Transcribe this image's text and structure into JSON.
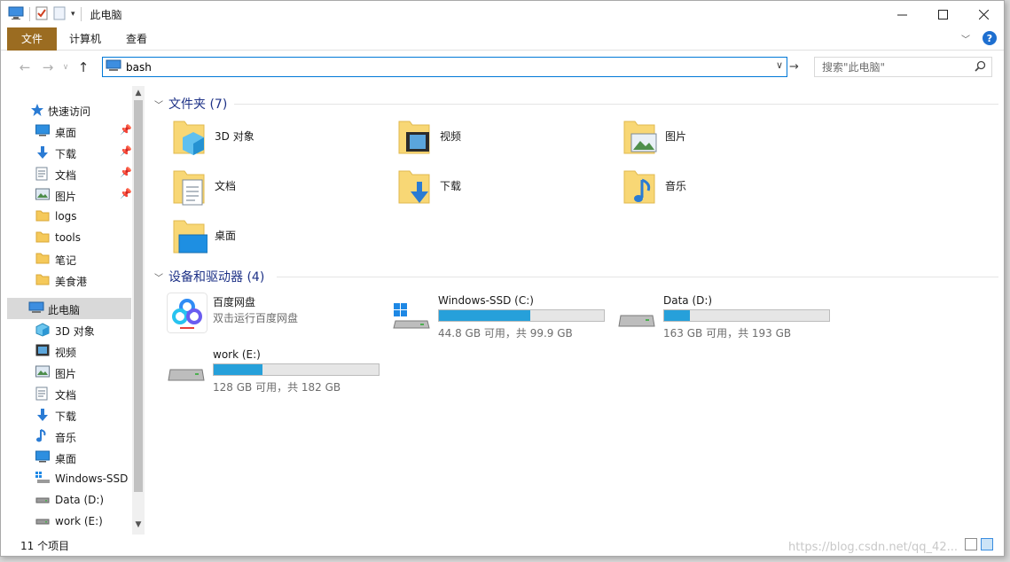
{
  "window": {
    "title": "此电脑"
  },
  "ribbon": {
    "tabs": [
      {
        "label": "文件"
      },
      {
        "label": "计算机"
      },
      {
        "label": "查看"
      }
    ],
    "help_label": "?"
  },
  "nav": {
    "address_value": "bash",
    "search_placeholder": "搜索\"此电脑\""
  },
  "sidebar": {
    "items": [
      {
        "label": "快速访问",
        "icon": "star-icon",
        "pinned": false
      },
      {
        "label": "桌面",
        "icon": "desktop-icon",
        "pinned": true
      },
      {
        "label": "下载",
        "icon": "download-icon",
        "pinned": true
      },
      {
        "label": "文档",
        "icon": "document-icon",
        "pinned": true
      },
      {
        "label": "图片",
        "icon": "picture-icon",
        "pinned": true
      },
      {
        "label": "logs",
        "icon": "folder-icon",
        "pinned": false
      },
      {
        "label": "tools",
        "icon": "folder-icon",
        "pinned": false
      },
      {
        "label": "笔记",
        "icon": "folder-icon",
        "pinned": false
      },
      {
        "label": "美食港",
        "icon": "folder-icon",
        "pinned": false
      },
      {
        "label": "此电脑",
        "icon": "computer-icon",
        "pinned": false,
        "selected": true
      },
      {
        "label": "3D 对象",
        "icon": "3d-objects-icon",
        "pinned": false
      },
      {
        "label": "视频",
        "icon": "video-icon",
        "pinned": false
      },
      {
        "label": "图片",
        "icon": "picture-icon",
        "pinned": false
      },
      {
        "label": "文档",
        "icon": "document-icon",
        "pinned": false
      },
      {
        "label": "下载",
        "icon": "download-icon",
        "pinned": false
      },
      {
        "label": "音乐",
        "icon": "music-icon",
        "pinned": false
      },
      {
        "label": "桌面",
        "icon": "desktop-icon",
        "pinned": false
      },
      {
        "label": "Windows-SSD",
        "icon": "windows-drive-icon",
        "pinned": false
      },
      {
        "label": "Data (D:)",
        "icon": "drive-icon",
        "pinned": false
      },
      {
        "label": "work (E:)",
        "icon": "drive-icon",
        "pinned": false
      }
    ]
  },
  "folders_group": {
    "title": "文件夹 (7)",
    "items": [
      {
        "label": "3D 对象",
        "icon": "3d-objects-folder-icon"
      },
      {
        "label": "视频",
        "icon": "video-folder-icon"
      },
      {
        "label": "图片",
        "icon": "picture-folder-icon"
      },
      {
        "label": "文档",
        "icon": "document-folder-icon"
      },
      {
        "label": "下载",
        "icon": "download-folder-icon"
      },
      {
        "label": "音乐",
        "icon": "music-folder-icon"
      },
      {
        "label": "桌面",
        "icon": "desktop-folder-icon"
      }
    ]
  },
  "devices_group": {
    "title": "设备和驱动器 (4)",
    "items": [
      {
        "name": "百度网盘",
        "subtitle": "双击运行百度网盘",
        "icon": "baidu-netdisk-icon"
      },
      {
        "name": "Windows-SSD (C:)",
        "size_text": "44.8 GB 可用，共 99.9 GB",
        "used_fraction": 0.552,
        "icon": "windows-drive-icon"
      },
      {
        "name": "Data (D:)",
        "size_text": "163 GB 可用，共 193 GB",
        "used_fraction": 0.155,
        "icon": "drive-icon"
      },
      {
        "name": "work (E:)",
        "size_text": "128 GB 可用，共 182 GB",
        "used_fraction": 0.297,
        "icon": "drive-icon"
      }
    ]
  },
  "status": {
    "item_count": "11 个项目",
    "watermark": "https://blog.csdn.net/qq_42..."
  },
  "colors": {
    "file_tab": "#9b6c21",
    "accent": "#0078d7",
    "drive_bar": "#26a0da",
    "group_title": "#1e3287"
  }
}
